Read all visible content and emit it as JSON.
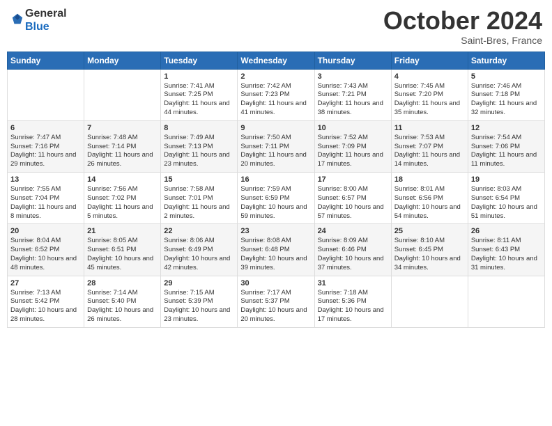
{
  "header": {
    "logo_general": "General",
    "logo_blue": "Blue",
    "month_title": "October 2024",
    "location": "Saint-Bres, France"
  },
  "days_of_week": [
    "Sunday",
    "Monday",
    "Tuesday",
    "Wednesday",
    "Thursday",
    "Friday",
    "Saturday"
  ],
  "weeks": [
    [
      {
        "day": "",
        "info": ""
      },
      {
        "day": "",
        "info": ""
      },
      {
        "day": "1",
        "info": "Sunrise: 7:41 AM\nSunset: 7:25 PM\nDaylight: 11 hours and 44 minutes."
      },
      {
        "day": "2",
        "info": "Sunrise: 7:42 AM\nSunset: 7:23 PM\nDaylight: 11 hours and 41 minutes."
      },
      {
        "day": "3",
        "info": "Sunrise: 7:43 AM\nSunset: 7:21 PM\nDaylight: 11 hours and 38 minutes."
      },
      {
        "day": "4",
        "info": "Sunrise: 7:45 AM\nSunset: 7:20 PM\nDaylight: 11 hours and 35 minutes."
      },
      {
        "day": "5",
        "info": "Sunrise: 7:46 AM\nSunset: 7:18 PM\nDaylight: 11 hours and 32 minutes."
      }
    ],
    [
      {
        "day": "6",
        "info": "Sunrise: 7:47 AM\nSunset: 7:16 PM\nDaylight: 11 hours and 29 minutes."
      },
      {
        "day": "7",
        "info": "Sunrise: 7:48 AM\nSunset: 7:14 PM\nDaylight: 11 hours and 26 minutes."
      },
      {
        "day": "8",
        "info": "Sunrise: 7:49 AM\nSunset: 7:13 PM\nDaylight: 11 hours and 23 minutes."
      },
      {
        "day": "9",
        "info": "Sunrise: 7:50 AM\nSunset: 7:11 PM\nDaylight: 11 hours and 20 minutes."
      },
      {
        "day": "10",
        "info": "Sunrise: 7:52 AM\nSunset: 7:09 PM\nDaylight: 11 hours and 17 minutes."
      },
      {
        "day": "11",
        "info": "Sunrise: 7:53 AM\nSunset: 7:07 PM\nDaylight: 11 hours and 14 minutes."
      },
      {
        "day": "12",
        "info": "Sunrise: 7:54 AM\nSunset: 7:06 PM\nDaylight: 11 hours and 11 minutes."
      }
    ],
    [
      {
        "day": "13",
        "info": "Sunrise: 7:55 AM\nSunset: 7:04 PM\nDaylight: 11 hours and 8 minutes."
      },
      {
        "day": "14",
        "info": "Sunrise: 7:56 AM\nSunset: 7:02 PM\nDaylight: 11 hours and 5 minutes."
      },
      {
        "day": "15",
        "info": "Sunrise: 7:58 AM\nSunset: 7:01 PM\nDaylight: 11 hours and 2 minutes."
      },
      {
        "day": "16",
        "info": "Sunrise: 7:59 AM\nSunset: 6:59 PM\nDaylight: 10 hours and 59 minutes."
      },
      {
        "day": "17",
        "info": "Sunrise: 8:00 AM\nSunset: 6:57 PM\nDaylight: 10 hours and 57 minutes."
      },
      {
        "day": "18",
        "info": "Sunrise: 8:01 AM\nSunset: 6:56 PM\nDaylight: 10 hours and 54 minutes."
      },
      {
        "day": "19",
        "info": "Sunrise: 8:03 AM\nSunset: 6:54 PM\nDaylight: 10 hours and 51 minutes."
      }
    ],
    [
      {
        "day": "20",
        "info": "Sunrise: 8:04 AM\nSunset: 6:52 PM\nDaylight: 10 hours and 48 minutes."
      },
      {
        "day": "21",
        "info": "Sunrise: 8:05 AM\nSunset: 6:51 PM\nDaylight: 10 hours and 45 minutes."
      },
      {
        "day": "22",
        "info": "Sunrise: 8:06 AM\nSunset: 6:49 PM\nDaylight: 10 hours and 42 minutes."
      },
      {
        "day": "23",
        "info": "Sunrise: 8:08 AM\nSunset: 6:48 PM\nDaylight: 10 hours and 39 minutes."
      },
      {
        "day": "24",
        "info": "Sunrise: 8:09 AM\nSunset: 6:46 PM\nDaylight: 10 hours and 37 minutes."
      },
      {
        "day": "25",
        "info": "Sunrise: 8:10 AM\nSunset: 6:45 PM\nDaylight: 10 hours and 34 minutes."
      },
      {
        "day": "26",
        "info": "Sunrise: 8:11 AM\nSunset: 6:43 PM\nDaylight: 10 hours and 31 minutes."
      }
    ],
    [
      {
        "day": "27",
        "info": "Sunrise: 7:13 AM\nSunset: 5:42 PM\nDaylight: 10 hours and 28 minutes."
      },
      {
        "day": "28",
        "info": "Sunrise: 7:14 AM\nSunset: 5:40 PM\nDaylight: 10 hours and 26 minutes."
      },
      {
        "day": "29",
        "info": "Sunrise: 7:15 AM\nSunset: 5:39 PM\nDaylight: 10 hours and 23 minutes."
      },
      {
        "day": "30",
        "info": "Sunrise: 7:17 AM\nSunset: 5:37 PM\nDaylight: 10 hours and 20 minutes."
      },
      {
        "day": "31",
        "info": "Sunrise: 7:18 AM\nSunset: 5:36 PM\nDaylight: 10 hours and 17 minutes."
      },
      {
        "day": "",
        "info": ""
      },
      {
        "day": "",
        "info": ""
      }
    ]
  ]
}
